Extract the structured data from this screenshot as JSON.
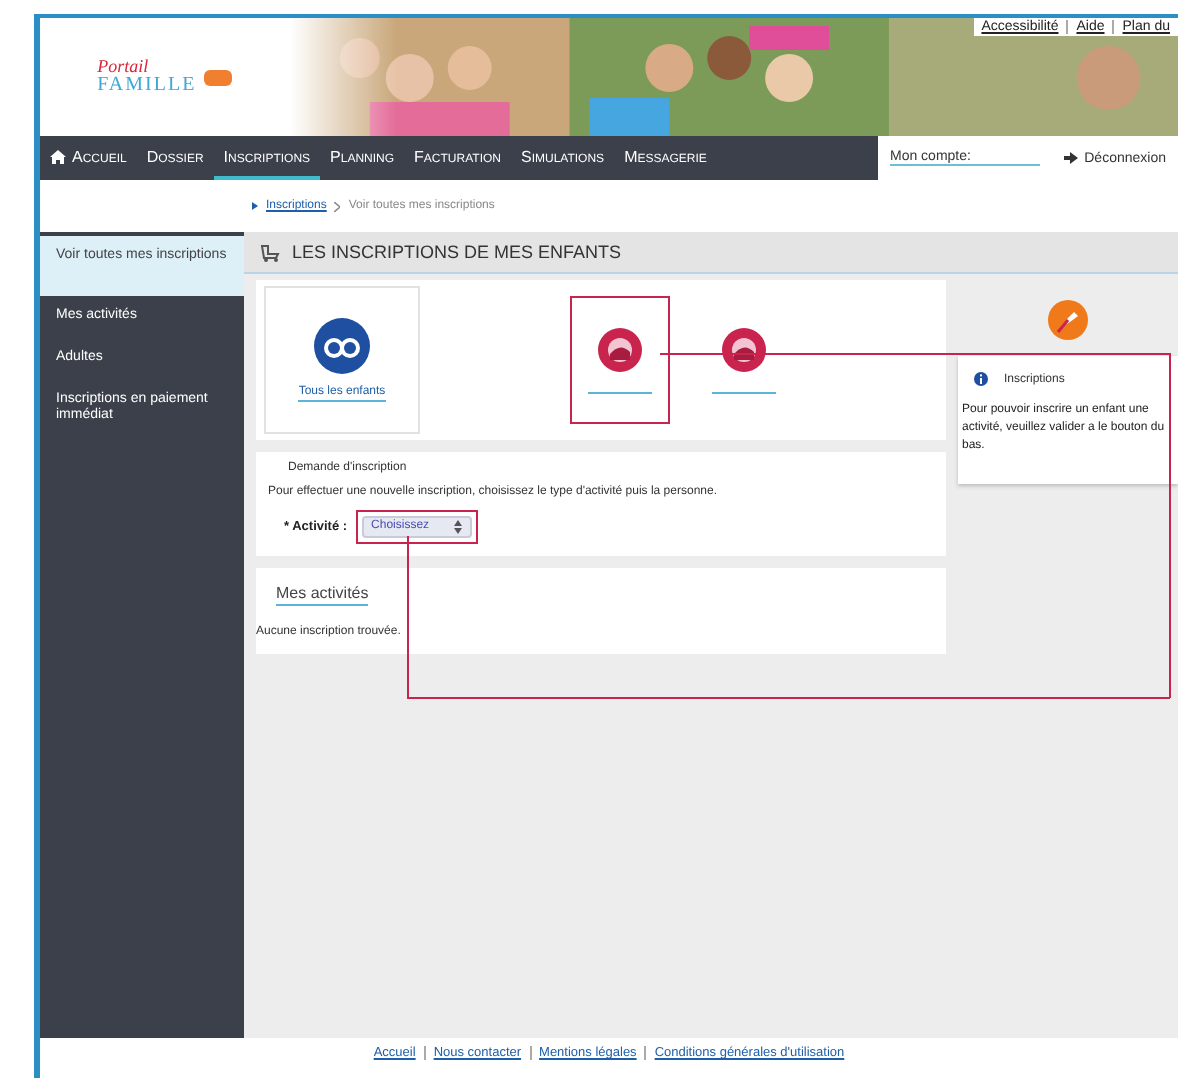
{
  "header": {
    "logo_top": "Portail",
    "logo_bottom": "FAMILLE",
    "top_links": [
      "Accessibilité",
      "Aide",
      "Plan du"
    ]
  },
  "nav": {
    "items": [
      {
        "label": "Accueil",
        "selected": false,
        "kind": "home"
      },
      {
        "label": "Dossier",
        "selected": false,
        "kind": "plain"
      },
      {
        "label": "Inscriptions",
        "selected": true,
        "kind": "plain"
      },
      {
        "label": "Planning",
        "selected": false,
        "kind": "plain"
      },
      {
        "label": "Facturation",
        "selected": false,
        "kind": "plain"
      },
      {
        "label": "Simulations",
        "selected": false,
        "kind": "plain"
      },
      {
        "label": "Messagerie",
        "selected": false,
        "kind": "plain"
      }
    ],
    "account_label": "Mon compte:",
    "logout": "Déconnexion"
  },
  "breadcrumb": [
    "Inscriptions",
    "Voir toutes mes inscriptions"
  ],
  "sidebar": {
    "items": [
      {
        "label": "Voir toutes mes inscriptions",
        "selected": true
      },
      {
        "label": "Mes activités",
        "selected": false
      },
      {
        "label": "Adultes",
        "selected": false
      },
      {
        "label": "Inscriptions en paiement immédiat",
        "selected": false
      }
    ]
  },
  "page_title": "LES INSCRIPTIONS DE MES ENFANTS",
  "persons": [
    {
      "kind": "group",
      "label": "Tous les enfants"
    },
    {
      "kind": "child",
      "callout": true
    },
    {
      "kind": "child",
      "callout": false
    }
  ],
  "request": {
    "title": "Demande d'inscription",
    "text": "Pour effectuer une nouvelle inscription, choisissez le type d'activité puis la personne.",
    "field_label": "* Activité :",
    "select_value": "Choisissez",
    "callout": true
  },
  "activities": {
    "title": "Mes activités",
    "empty": "Aucune inscription trouvée."
  },
  "info": {
    "title": "Inscriptions",
    "text": "Pour pouvoir inscrire un enfant une activité, veuillez valider a le bouton du bas."
  },
  "footer": [
    "Accueil",
    "Nous contacter",
    "Mentions légales",
    "Conditions générales d'utilisation"
  ]
}
